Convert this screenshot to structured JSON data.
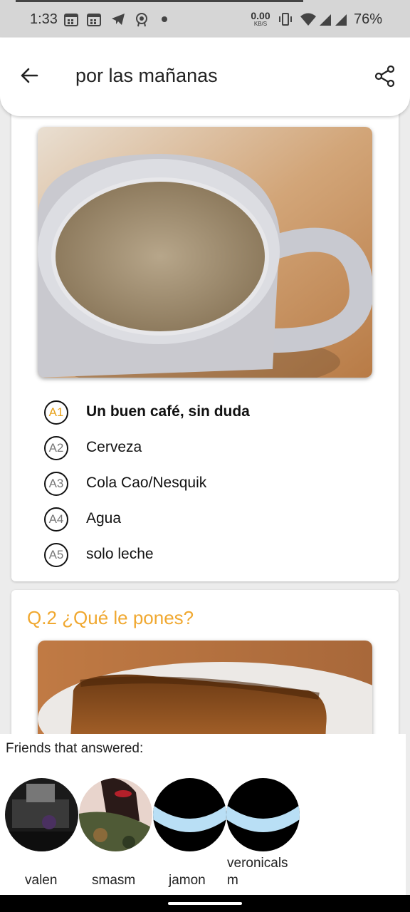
{
  "status_bar": {
    "time": "1:33",
    "network_speed_value": "0.00",
    "network_speed_unit": "KB/S",
    "battery": "76%",
    "icons": [
      "calendar-icon",
      "calendar-icon",
      "telegram-icon",
      "badge-icon",
      "dot-icon",
      "vibrate-icon",
      "wifi-icon",
      "signal-icon",
      "signal-icon"
    ]
  },
  "app_bar": {
    "title": "por las mañanas",
    "back_icon": "arrow-left-icon",
    "share_icon": "share-icon"
  },
  "question_1": {
    "answers": [
      {
        "badge": "A1",
        "label": "Un buen café, sin duda",
        "selected": true
      },
      {
        "badge": "A2",
        "label": "Cerveza",
        "selected": false
      },
      {
        "badge": "A3",
        "label": "Cola Cao/Nesquik",
        "selected": false
      },
      {
        "badge": "A4",
        "label": "Agua",
        "selected": false
      },
      {
        "badge": "A5",
        "label": "solo leche",
        "selected": false
      }
    ]
  },
  "question_2": {
    "title": "Q.2 ¿Qué le pones?"
  },
  "friends_panel": {
    "title": "Friends that answered:",
    "friends": [
      {
        "name": "valen"
      },
      {
        "name": "smasm"
      },
      {
        "name": "jamon"
      },
      {
        "name": "veronicals m"
      }
    ]
  },
  "colors": {
    "accent": "#f0a830",
    "selected_badge": "#e8a21a"
  }
}
